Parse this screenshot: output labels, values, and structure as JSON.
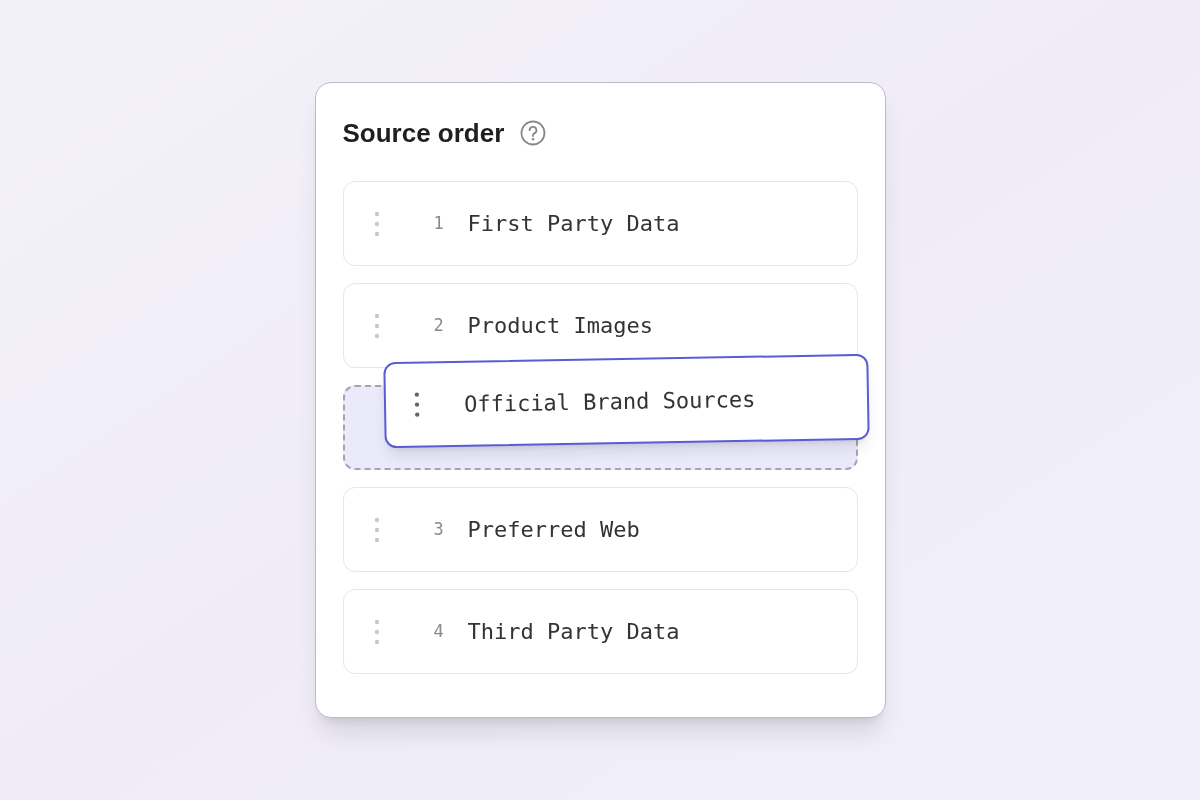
{
  "title": "Source order",
  "items": [
    {
      "kind": "item",
      "number": "1",
      "label": "First Party Data"
    },
    {
      "kind": "item",
      "number": "2",
      "label": "Product Images"
    },
    {
      "kind": "drop-slot",
      "dragged_label": "Official Brand Sources"
    },
    {
      "kind": "item",
      "number": "3",
      "label": "Preferred Web"
    },
    {
      "kind": "item",
      "number": "4",
      "label": "Third Party Data"
    }
  ]
}
